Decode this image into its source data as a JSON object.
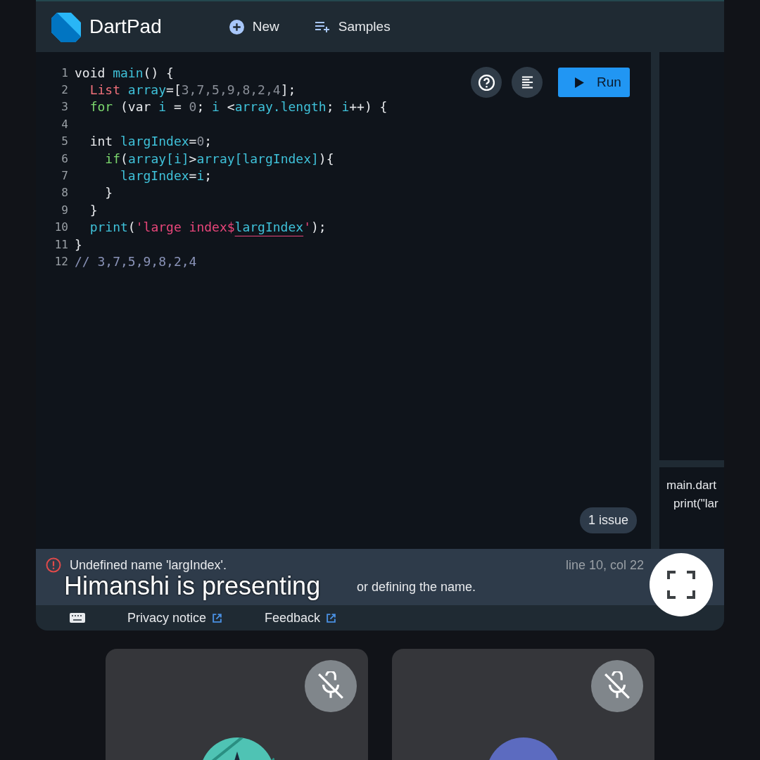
{
  "app": {
    "title": "DartPad",
    "nav": [
      {
        "kind": "new",
        "label": "New"
      },
      {
        "kind": "samples",
        "label": "Samples"
      }
    ]
  },
  "editor": {
    "run_label": "Run",
    "lines": [
      {
        "number": "1",
        "tokens": [
          {
            "text": "void ",
            "kind": "plain"
          },
          {
            "text": "main",
            "kind": "ident"
          },
          {
            "text": "() {",
            "kind": "plain"
          }
        ]
      },
      {
        "number": "2",
        "tokens": [
          {
            "text": "  List ",
            "kind": "type"
          },
          {
            "text": "array",
            "kind": "ident"
          },
          {
            "text": "=[",
            "kind": "plain"
          },
          {
            "text": "3,7,5,9,8,2,4",
            "kind": "number"
          },
          {
            "text": "];",
            "kind": "plain"
          }
        ]
      },
      {
        "number": "3",
        "tokens": [
          {
            "text": "  for ",
            "kind": "keyword"
          },
          {
            "text": "(var ",
            "kind": "plain"
          },
          {
            "text": "i",
            "kind": "ident"
          },
          {
            "text": " = ",
            "kind": "plain"
          },
          {
            "text": "0",
            "kind": "number"
          },
          {
            "text": "; ",
            "kind": "plain"
          },
          {
            "text": "i",
            "kind": "ident"
          },
          {
            "text": " <",
            "kind": "plain"
          },
          {
            "text": "array.length",
            "kind": "ident"
          },
          {
            "text": "; ",
            "kind": "plain"
          },
          {
            "text": "i",
            "kind": "ident"
          },
          {
            "text": "++) {",
            "kind": "plain"
          }
        ]
      },
      {
        "number": "4"
      },
      {
        "number": "5",
        "tokens": [
          {
            "text": "  int ",
            "kind": "plain"
          },
          {
            "text": "largIndex",
            "kind": "ident"
          },
          {
            "text": "=",
            "kind": "plain"
          },
          {
            "text": "0",
            "kind": "number"
          },
          {
            "text": ";",
            "kind": "plain"
          }
        ]
      },
      {
        "number": "6",
        "tokens": [
          {
            "text": "    if",
            "kind": "keyword"
          },
          {
            "text": "(",
            "kind": "plain"
          },
          {
            "text": "array[i]",
            "kind": "ident"
          },
          {
            "text": ">",
            "kind": "plain"
          },
          {
            "text": "array[largIndex]",
            "kind": "ident"
          },
          {
            "text": "){",
            "kind": "plain"
          }
        ]
      },
      {
        "number": "7",
        "tokens": [
          {
            "text": "      largIndex",
            "kind": "ident"
          },
          {
            "text": "=",
            "kind": "plain"
          },
          {
            "text": "i",
            "kind": "ident"
          },
          {
            "text": ";",
            "kind": "plain"
          }
        ]
      },
      {
        "number": "8",
        "tokens": [
          {
            "text": "    }",
            "kind": "plain"
          }
        ]
      },
      {
        "number": "9",
        "tokens": [
          {
            "text": "  }",
            "kind": "plain"
          }
        ]
      },
      {
        "number": "10",
        "tokens": [
          {
            "text": "  print",
            "kind": "ident"
          },
          {
            "text": "(",
            "kind": "plain"
          },
          {
            "text": "'large index$",
            "kind": "string"
          },
          {
            "text": "largIndex",
            "kind": "error"
          },
          {
            "text": "'",
            "kind": "string"
          },
          {
            "text": ");",
            "kind": "plain"
          }
        ]
      },
      {
        "number": "11",
        "tokens": [
          {
            "text": "}",
            "kind": "plain"
          }
        ]
      },
      {
        "number": "12",
        "tokens": [
          {
            "text": "// 3,7,5,9,8,2,4",
            "kind": "comment"
          }
        ]
      }
    ],
    "issue_count": "1 issue"
  },
  "console": {
    "lines": [
      "main.dart",
      "print(\"lar"
    ]
  },
  "issue": {
    "message": "Undefined name 'largIndex'.",
    "location": "line 10, col 22",
    "hint_visible": "or defining the name."
  },
  "footer": {
    "links": [
      "Privacy notice",
      "Feedback"
    ]
  },
  "presenting_banner": "Himanshi is presenting",
  "participants": [
    {
      "muted": true,
      "kind": "picture",
      "color": "#4fc3b4"
    },
    {
      "muted": true,
      "kind": "plain",
      "color": "#5c6bc0"
    }
  ]
}
